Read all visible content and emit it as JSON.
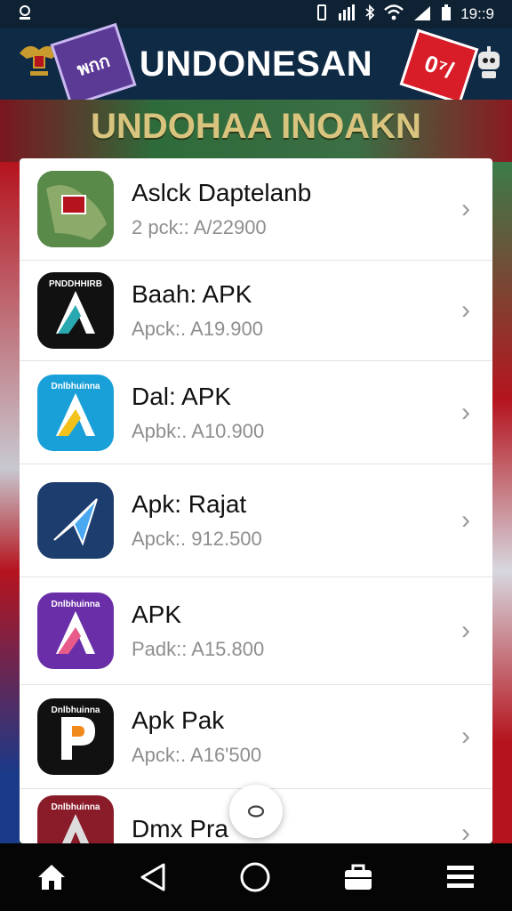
{
  "status_bar": {
    "time": "19::9"
  },
  "header": {
    "title": "UNDONESAN",
    "left_sticker_text": "พกก",
    "right_sticker_text": "0⁷/"
  },
  "banner": {
    "subtitle": "UNDOHAA INOAKN"
  },
  "apps": [
    {
      "name": "Aslck Daptelanb",
      "price": "2 pck:: A/22900",
      "icon": "map-icon",
      "icon_label": "",
      "bg": "#3b6b3a"
    },
    {
      "name": "Baah: APK",
      "price": "Apck:. A19.900",
      "icon": "letter-a-icon",
      "icon_label": "PNDDHHIRB",
      "bg": "#111111"
    },
    {
      "name": "Dal: APK",
      "price": "Apbk:. A10.900",
      "icon": "letter-a-icon",
      "icon_label": "Dnlbhuinna",
      "bg": "#1aa0d8"
    },
    {
      "name": "Apk: Rajat",
      "price": "Apck:. 912.500",
      "icon": "paper-plane-icon",
      "icon_label": "",
      "bg": "#1d3d6e"
    },
    {
      "name": "APK",
      "price": "Padk:: A15.800",
      "icon": "letter-a-icon",
      "icon_label": "Dnlbhuinna",
      "bg": "#6a2fa8"
    },
    {
      "name": "Apk Pak",
      "price": "Apck:. A16'500",
      "icon": "letter-p-icon",
      "icon_label": "Dnlbhuinna",
      "bg": "#111111"
    },
    {
      "name": "Dmx Pra",
      "price": "",
      "icon": "letter-a-icon",
      "icon_label": "Dnlbhuinna",
      "bg": "#8a1c2a"
    }
  ],
  "nav": {
    "items": [
      "home-icon",
      "back-icon",
      "home-circle-icon",
      "briefcase-icon",
      "menu-icon"
    ]
  }
}
